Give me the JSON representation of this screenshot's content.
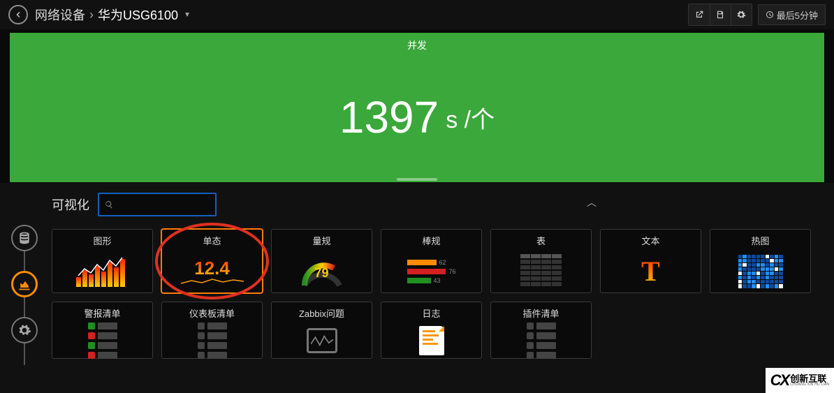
{
  "header": {
    "breadcrumb_root": "网络设备",
    "breadcrumb_current": "华为USG6100",
    "time_label": "最后5分钟"
  },
  "panel": {
    "title": "并发",
    "value": "1397",
    "unit": "s /个"
  },
  "viz": {
    "section_label": "可视化",
    "search_value": "",
    "cards_row1": [
      {
        "id": "graph",
        "label": "图形"
      },
      {
        "id": "singlestat",
        "label": "单态",
        "value": "12.4",
        "selected": true,
        "circled": true
      },
      {
        "id": "gauge",
        "label": "量规",
        "value": "79"
      },
      {
        "id": "bargauge",
        "label": "棒规",
        "bars": [
          62,
          76,
          43
        ]
      },
      {
        "id": "table",
        "label": "表"
      },
      {
        "id": "text",
        "label": "文本",
        "glyph": "T"
      },
      {
        "id": "heatmap",
        "label": "热图"
      }
    ],
    "cards_row2": [
      {
        "id": "alertlist",
        "label": "警报清单"
      },
      {
        "id": "dashlist",
        "label": "仪表板清单"
      },
      {
        "id": "zabbix",
        "label": "Zabbix问题"
      },
      {
        "id": "logs",
        "label": "日志"
      },
      {
        "id": "pluginlist",
        "label": "插件清单"
      }
    ]
  },
  "watermark": {
    "cn": "创新互联",
    "en": "CHUANG XIN HU LIAN"
  }
}
